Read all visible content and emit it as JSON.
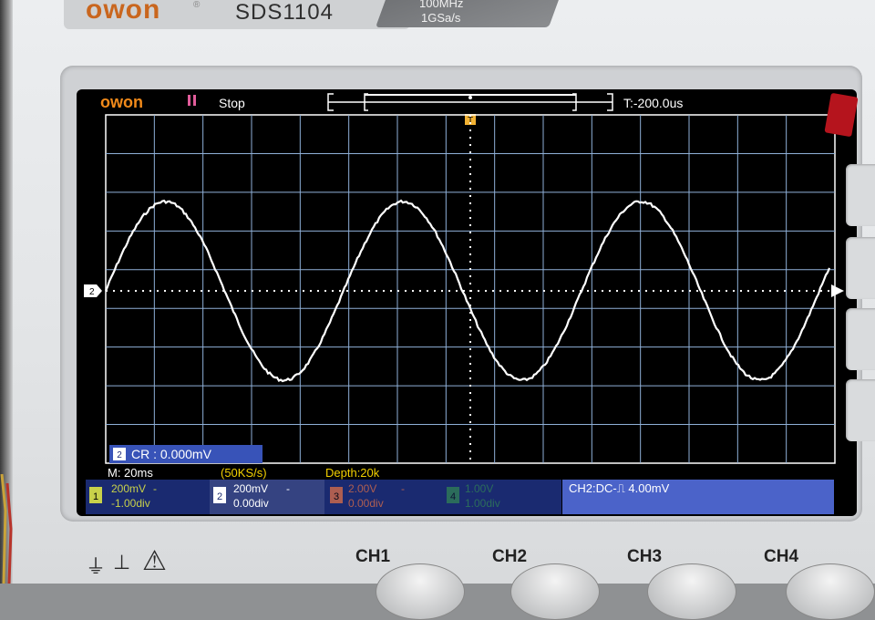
{
  "device": {
    "brand": "owon",
    "model": "SDS1104",
    "spec_bandwidth": "100MHz",
    "spec_sample_rate": "1GSa/s"
  },
  "topbar": {
    "logo": "owon",
    "status_icon": "pause-icon",
    "status": "Stop",
    "trigger_time": "T:-200.0us"
  },
  "cursor_readout": {
    "channel": "2",
    "text": "CR : 0.000mV"
  },
  "info_row": {
    "timebase": "M: 20ms",
    "sample_rate": "(50KS/s)",
    "depth": "Depth:20k"
  },
  "channels": [
    {
      "id": "1",
      "volts": "200mV",
      "coupling": "-",
      "offset": "-1.00div",
      "color": "#c8d14a"
    },
    {
      "id": "2",
      "volts": "200mV",
      "coupling": "-",
      "offset": "0.00div",
      "color": "#ffffff"
    },
    {
      "id": "3",
      "volts": "2.00V",
      "coupling": "-",
      "offset": "0.00div",
      "color": "#d26b4a"
    },
    {
      "id": "4",
      "volts": "1.00V",
      "coupling": "",
      "offset": "1.00div",
      "color": "#3aa34a"
    }
  ],
  "trigger_info": "CH2:DC-⎍ 4.00mV",
  "front_panel": {
    "channel_buttons": [
      "CH1",
      "CH2",
      "CH3",
      "CH4"
    ]
  },
  "colors": {
    "screen_bg": "#000000",
    "grid": "#8fb0d8",
    "trace": "#ffffff",
    "status_bar": "#1a2a70",
    "trigger_bar": "#4b63c9",
    "logo_orange": "#f28a1a"
  }
}
